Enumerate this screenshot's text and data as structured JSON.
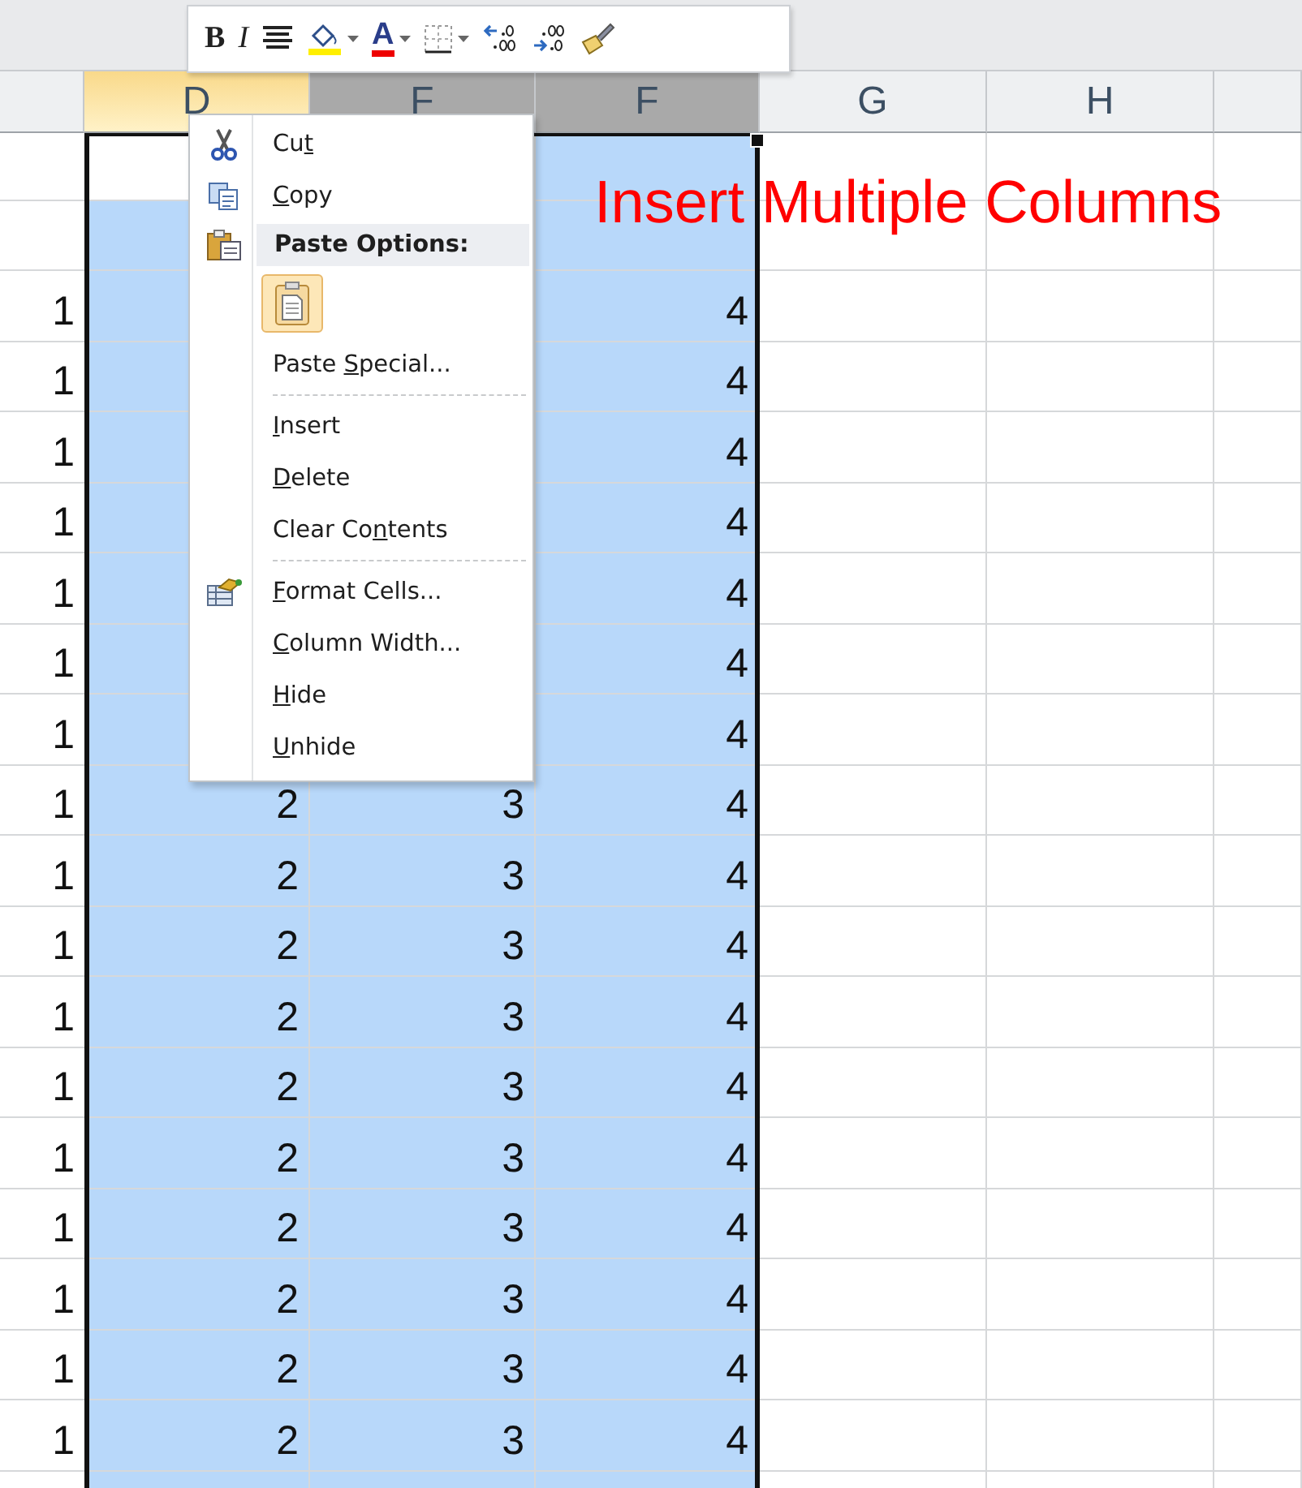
{
  "mini_toolbar": {
    "buttons": [
      {
        "kind": "bold",
        "label": "B"
      },
      {
        "kind": "italic",
        "label": "I"
      },
      {
        "kind": "align"
      },
      {
        "kind": "fill",
        "dropdown": true
      },
      {
        "kind": "font-color",
        "label": "A",
        "dropdown": true
      },
      {
        "kind": "borders",
        "dropdown": true
      },
      {
        "kind": "increase-decimal"
      },
      {
        "kind": "decrease-decimal"
      },
      {
        "kind": "painter"
      }
    ]
  },
  "columns": [
    {
      "selected": false,
      "active": false
    },
    {
      "label": "D",
      "selected": true,
      "active": true
    },
    {
      "label": "F",
      "selected": true,
      "active": false
    },
    {
      "label": "F",
      "selected": true,
      "active": false
    },
    {
      "label": "G",
      "selected": false,
      "active": false
    },
    {
      "label": "H",
      "selected": false,
      "active": false
    },
    {
      "selected": false,
      "active": false
    }
  ],
  "sheet_title": "Insert Multiple Columns",
  "rows": [
    {
      "active": true
    },
    {
      "active": false
    },
    {
      "active": false,
      "a": "1",
      "f": "4"
    },
    {
      "active": false,
      "a": "1",
      "f": "4"
    },
    {
      "active": false,
      "a": "1",
      "f": "4"
    },
    {
      "active": false,
      "a": "1",
      "f": "4"
    },
    {
      "active": false,
      "a": "1",
      "f": "4"
    },
    {
      "active": false,
      "a": "1",
      "f": "4"
    },
    {
      "active": false,
      "a": "1",
      "f": "4"
    },
    {
      "active": false,
      "a": "1",
      "d": "2",
      "e": "3",
      "f": "4"
    },
    {
      "active": false,
      "a": "1",
      "d": "2",
      "e": "3",
      "f": "4"
    },
    {
      "active": false,
      "a": "1",
      "d": "2",
      "e": "3",
      "f": "4"
    },
    {
      "active": false,
      "a": "1",
      "d": "2",
      "e": "3",
      "f": "4"
    },
    {
      "active": false,
      "a": "1",
      "d": "2",
      "e": "3",
      "f": "4"
    },
    {
      "active": false,
      "a": "1",
      "d": "2",
      "e": "3",
      "f": "4"
    },
    {
      "active": false,
      "a": "1",
      "d": "2",
      "e": "3",
      "f": "4"
    },
    {
      "active": false,
      "a": "1",
      "d": "2",
      "e": "3",
      "f": "4"
    },
    {
      "active": false,
      "a": "1",
      "d": "2",
      "e": "3",
      "f": "4"
    },
    {
      "active": false,
      "a": "1",
      "d": "2",
      "e": "3",
      "f": "4"
    }
  ],
  "context_menu": [
    {
      "kind": "item",
      "has_icon": true,
      "before": "Cu",
      "key": "t"
    },
    {
      "kind": "item",
      "has_icon": true,
      "key": "C",
      "after": "opy"
    },
    {
      "kind": "header",
      "has_icon": true,
      "label": "Paste Options:"
    },
    {
      "kind": "paste-option"
    },
    {
      "kind": "item",
      "has_icon": false,
      "before": "Paste ",
      "key": "S",
      "after": "pecial..."
    },
    {
      "kind": "separator"
    },
    {
      "kind": "item",
      "has_icon": false,
      "key": "I",
      "after": "nsert"
    },
    {
      "kind": "item",
      "has_icon": false,
      "key": "D",
      "after": "elete"
    },
    {
      "kind": "item",
      "has_icon": false,
      "before": "Clear Co",
      "key": "n",
      "after": "tents"
    },
    {
      "kind": "separator"
    },
    {
      "kind": "item",
      "has_icon": true,
      "key": "F",
      "after": "ormat Cells..."
    },
    {
      "kind": "item",
      "has_icon": false,
      "key": "C",
      "after": "olumn Width..."
    },
    {
      "kind": "item",
      "has_icon": false,
      "key": "H",
      "after": "ide"
    },
    {
      "kind": "item",
      "has_icon": false,
      "key": "U",
      "after": "nhide"
    }
  ]
}
